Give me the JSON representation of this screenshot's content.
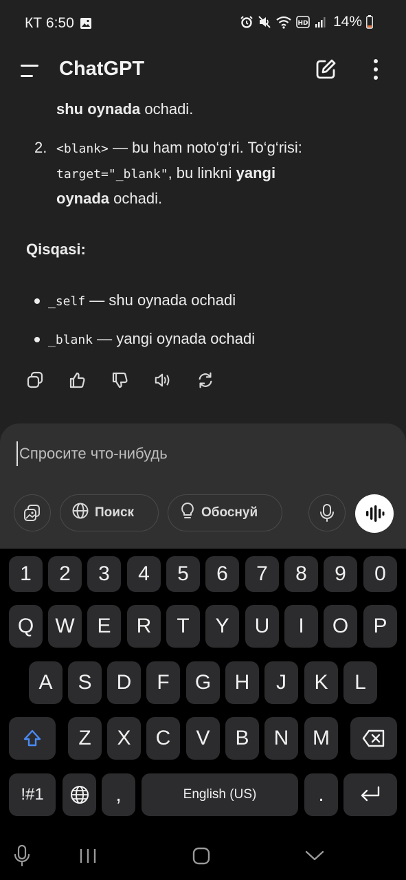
{
  "status": {
    "time": "КТ 6:50",
    "battery": "14%",
    "icons": [
      "gallery-icon",
      "alarm-icon",
      "mute-icon",
      "wifi-icon",
      "hd-icon",
      "signal-icon",
      "battery-icon"
    ]
  },
  "appbar": {
    "title": "ChatGPT",
    "icons": [
      "menu-icon",
      "new-chat-icon",
      "more-icon"
    ]
  },
  "message": {
    "line0_bold": "shu oynada",
    "line0_rest": " ochadi.",
    "item2_num": "2.",
    "item2_code1": "<blank>",
    "item2_text1": " — bu ham noto‘g‘ri. To‘g‘risi:",
    "item2_code2": "target=\"_blank\"",
    "item2_text2": ", bu linkni ",
    "item2_bold1": "yangi",
    "item2_bold2": "oynada",
    "item2_text3": " ochadi.",
    "summary_title": "Qisqasi:",
    "bullets": [
      {
        "code": "_self",
        "text": " — shu oynada ochadi"
      },
      {
        "code": "_blank",
        "text": " — yangi oynada ochadi"
      }
    ]
  },
  "actions": [
    "copy-icon",
    "thumbs-up-icon",
    "thumbs-down-icon",
    "read-aloud-icon",
    "regenerate-icon"
  ],
  "composer": {
    "placeholder": "Спросите что-нибудь",
    "search_label": "Поиск",
    "reason_label": "Обоснуй"
  },
  "keyboard": {
    "row_numbers": [
      "1",
      "2",
      "3",
      "4",
      "5",
      "6",
      "7",
      "8",
      "9",
      "0"
    ],
    "row1": [
      "Q",
      "W",
      "E",
      "R",
      "T",
      "Y",
      "U",
      "I",
      "O",
      "P"
    ],
    "row2": [
      "A",
      "S",
      "D",
      "F",
      "G",
      "H",
      "J",
      "K",
      "L"
    ],
    "row3": [
      "Z",
      "X",
      "C",
      "V",
      "B",
      "N",
      "M"
    ],
    "symbols_label": "!#1",
    "comma": ",",
    "space_label": "English (US)",
    "period": "."
  },
  "colors": {
    "background": "#212121",
    "composer": "#303030",
    "key": "#2c2c2e",
    "shift_accent": "#4a8bf5"
  }
}
